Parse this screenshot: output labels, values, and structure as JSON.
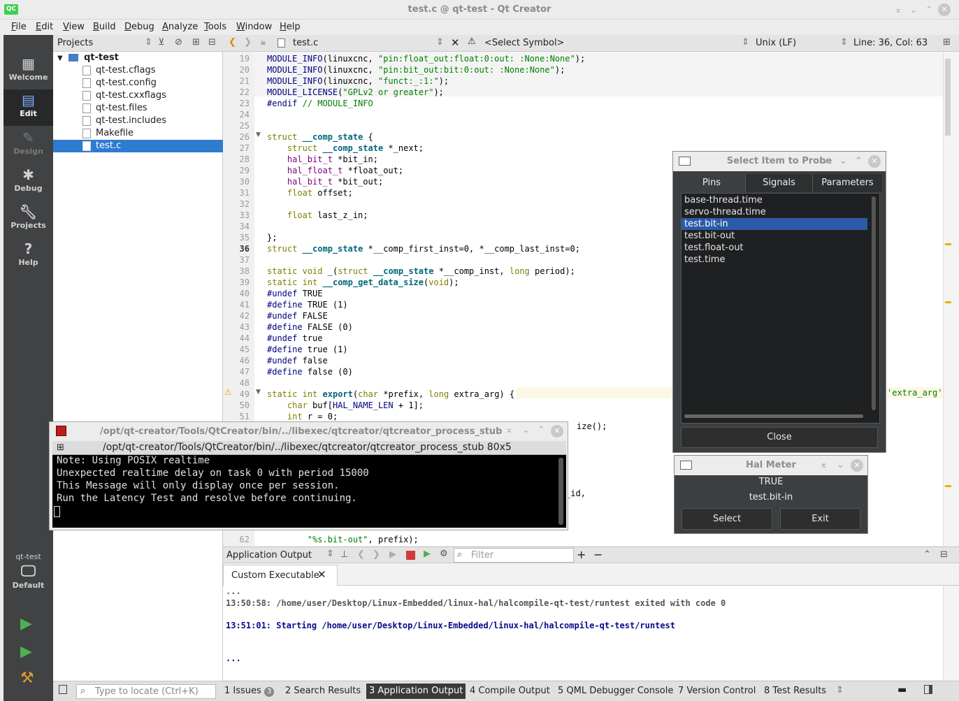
{
  "window": {
    "title": "test.c @ qt-test - Qt Creator",
    "logo": "QC"
  },
  "menu": [
    "File",
    "Edit",
    "View",
    "Build",
    "Debug",
    "Analyze",
    "Tools",
    "Window",
    "Help"
  ],
  "modes": {
    "welcome": "Welcome",
    "edit": "Edit",
    "design": "Design",
    "debug": "Debug",
    "projects": "Projects",
    "help": "Help",
    "kit_project": "qt-test",
    "kit_config": "Default"
  },
  "projects": {
    "header": "Projects",
    "root": "qt-test",
    "files": [
      "qt-test.cflags",
      "qt-test.config",
      "qt-test.cxxflags",
      "qt-test.files",
      "qt-test.includes",
      "Makefile",
      "test.c"
    ],
    "selected": "test.c"
  },
  "editor_toolbar": {
    "file": "test.c",
    "symbol": "<Select Symbol>",
    "line_ending": "Unix (LF)",
    "position": "Line: 36, Col: 63"
  },
  "code_lines": [
    {
      "n": "19",
      "t": "MODULE_INFO(linuxcnc, \"pin:float_out:float:0:out: :None:None\");"
    },
    {
      "n": "20",
      "t": "MODULE_INFO(linuxcnc, \"pin:bit_out:bit:0:out: :None:None\");"
    },
    {
      "n": "21",
      "t": "MODULE_INFO(linuxcnc, \"funct:_:1:\");"
    },
    {
      "n": "22",
      "t": "MODULE_LICENSE(\"GPLv2 or greater\");"
    },
    {
      "n": "23",
      "t": "#endif // MODULE_INFO"
    },
    {
      "n": "24",
      "t": ""
    },
    {
      "n": "25",
      "t": ""
    },
    {
      "n": "26",
      "t": "struct __comp_state {"
    },
    {
      "n": "27",
      "t": "    struct __comp_state *_next;"
    },
    {
      "n": "28",
      "t": "    hal_bit_t *bit_in;"
    },
    {
      "n": "29",
      "t": "    hal_float_t *float_out;"
    },
    {
      "n": "30",
      "t": "    hal_bit_t *bit_out;"
    },
    {
      "n": "31",
      "t": "    float offset;"
    },
    {
      "n": "32",
      "t": ""
    },
    {
      "n": "33",
      "t": "    float last_z_in;"
    },
    {
      "n": "34",
      "t": ""
    },
    {
      "n": "35",
      "t": "};"
    },
    {
      "n": "36",
      "t": "struct __comp_state *__comp_first_inst=0, *__comp_last_inst=0;"
    },
    {
      "n": "37",
      "t": ""
    },
    {
      "n": "38",
      "t": "static void _(struct __comp_state *__comp_inst, long period);"
    },
    {
      "n": "39",
      "t": "static int __comp_get_data_size(void);"
    },
    {
      "n": "40",
      "t": "#undef TRUE"
    },
    {
      "n": "41",
      "t": "#define TRUE (1)"
    },
    {
      "n": "42",
      "t": "#undef FALSE"
    },
    {
      "n": "43",
      "t": "#define FALSE (0)"
    },
    {
      "n": "44",
      "t": "#undef true"
    },
    {
      "n": "45",
      "t": "#define true (1)"
    },
    {
      "n": "46",
      "t": "#undef false"
    },
    {
      "n": "47",
      "t": "#define false (0)"
    },
    {
      "n": "48",
      "t": ""
    },
    {
      "n": "49",
      "t": "static int export(char *prefix, long extra_arg) {"
    },
    {
      "n": "50",
      "t": "    char buf[HAL_NAME_LEN + 1];"
    },
    {
      "n": "51",
      "t": "    int r = 0;"
    },
    {
      "n": "62",
      "t": "        \"%s.bit-out\", prefix);"
    }
  ],
  "code_fragments": {
    "line52": "ize();",
    "line58": "_id,",
    "warning_tail": "'extra_arg'"
  },
  "probe": {
    "title": "Select Item to Probe",
    "tabs": [
      "Pins",
      "Signals",
      "Parameters"
    ],
    "items": [
      "base-thread.time",
      "servo-thread.time",
      "test.bit-in",
      "test.bit-out",
      "test.float-out",
      "test.time"
    ],
    "selected": "test.bit-in",
    "close": "Close"
  },
  "halmeter": {
    "title": "Hal Meter",
    "value": "TRUE",
    "pin": "test.bit-in",
    "select": "Select",
    "exit": "Exit"
  },
  "terminal": {
    "title": "/opt/qt-creator/Tools/QtCreator/bin/../libexec/qtcreator/qtcreator_process_stub",
    "subtitle": "/opt/qt-creator/Tools/QtCreator/bin/../libexec/qtcreator/qtcreator_process_stub 80x5",
    "lines": [
      "Note: Using POSIX realtime",
      "Unexpected realtime delay on task 0 with period 15000",
      "This Message will only display once per session.",
      "Run the Latency Test and resolve before continuing."
    ]
  },
  "output": {
    "header": "Application Output",
    "filter_placeholder": "Filter",
    "tab": "Custom Executable",
    "lines": [
      "...",
      "13:50:58: /home/user/Desktop/Linux-Embedded/linux-hal/halcompile-qt-test/runtest exited with code 0",
      "13:51:01: Starting /home/user/Desktop/Linux-Embedded/linux-hal/halcompile-qt-test/runtest",
      "..."
    ]
  },
  "statusbar": {
    "locate_placeholder": "Type to locate (Ctrl+K)",
    "tabs": [
      "1  Issues",
      "2  Search Results",
      "3  Application Output",
      "4  Compile Output",
      "5  QML Debugger Console",
      "7  Version Control",
      "8  Test Results"
    ],
    "issues_count": "3"
  },
  "colors": {
    "selection": "#2f7bd0",
    "mode_bar": "#404244",
    "dialog_bg": "#3c3f41",
    "run_green": "#4cb050"
  }
}
